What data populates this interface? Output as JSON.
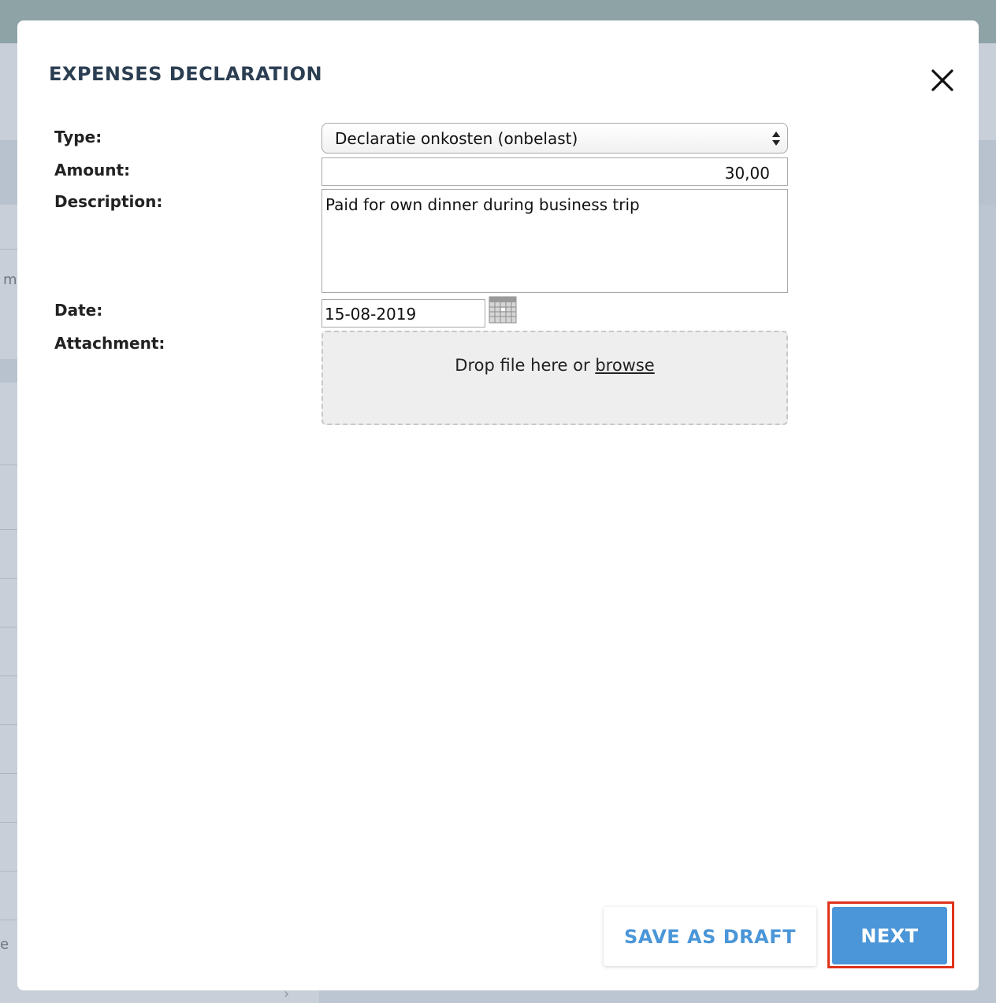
{
  "background": {
    "fragments": [
      "m",
      "e"
    ]
  },
  "modal": {
    "title": "EXPENSES DECLARATION",
    "close_icon": "close-icon"
  },
  "form": {
    "type_label": "Type:",
    "type_value": "Declaratie onkosten (onbelast)",
    "amount_label": "Amount:",
    "amount_value": "30,00",
    "description_label": "Description:",
    "description_value": "Paid for own dinner during business trip",
    "date_label": "Date:",
    "date_value": "15-08-2019",
    "calendar_icon": "calendar-icon",
    "attachment_label": "Attachment:",
    "dropzone_text": "Drop file here or",
    "browse_link": "browse"
  },
  "footer": {
    "save_draft_label": "SAVE AS DRAFT",
    "next_label": "NEXT",
    "highlight_color": "#e0331c",
    "accent_color": "#4a96d8"
  }
}
